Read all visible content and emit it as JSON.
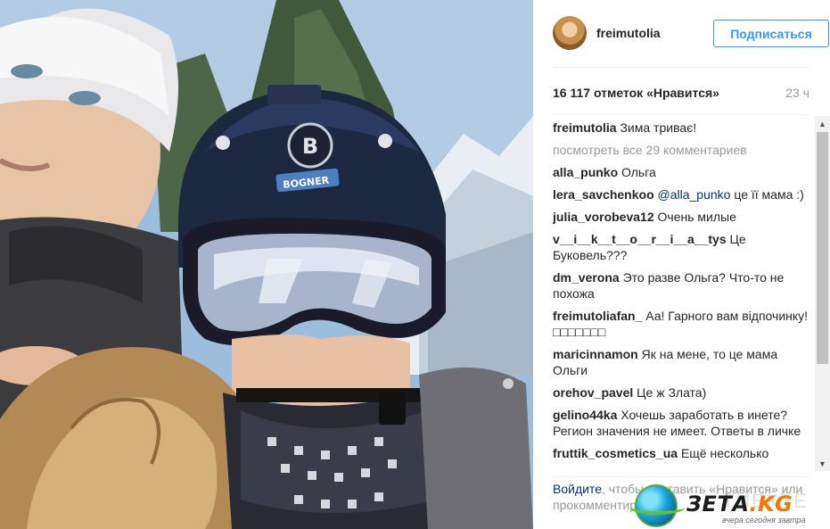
{
  "post": {
    "username": "freimutolia",
    "follow_label": "Подписаться",
    "likes": "16 117 отметок «Нравится»",
    "time": "23 ч"
  },
  "comments": {
    "caption": {
      "user": "freimutolia",
      "text": "Зима триває!"
    },
    "view_all": "посмотреть все 29 комментариев",
    "items": [
      {
        "user": "alla_punko",
        "text": "Ольга"
      },
      {
        "user": "lera_savchenkoo",
        "mention": "@alla_punko",
        "text": "це її мама :)"
      },
      {
        "user": "julia_vorobeva12",
        "text": "Очень милые"
      },
      {
        "user": "v__i__k__t__o__r__i__a__tys",
        "text": "Це Буковель???"
      },
      {
        "user": "dm_verona",
        "text": "Это разве Ольга? Что-то не похожа"
      },
      {
        "user": "freimutoliafan_",
        "text": "Аа! Гарного вам відпочинку! □□□□□□□"
      },
      {
        "user": "maricinnamon",
        "text": "Як на мене, то це мама Ольги"
      },
      {
        "user": "orehov_pavel",
        "text": "Це ж Злата)"
      },
      {
        "user": "gelino44ka",
        "text": "Хочешь заработать в инете? Регион значения не имеет. Ответы в личке"
      },
      {
        "user": "fruttik_cosmetics_ua",
        "text": "Ещё несколько"
      }
    ]
  },
  "footer": {
    "login_link": "Войдите",
    "text_after_login": ", чтобы поставить «Нравится» или прокомментировать."
  },
  "photo": {
    "helmet_logo": "B",
    "helmet_label": "BOGNER"
  },
  "watermark": {
    "brand": "ЗЕТА",
    "brand_suffix": ".KG",
    "ghost_text": "ТИЕКТЕ",
    "tagline": "вчера сегодня завтра"
  },
  "icons": {
    "scroll_up": "▲",
    "scroll_down": "▼"
  },
  "colors": {
    "accent": "#3897f0",
    "link": "#003569",
    "muted": "#999999"
  }
}
